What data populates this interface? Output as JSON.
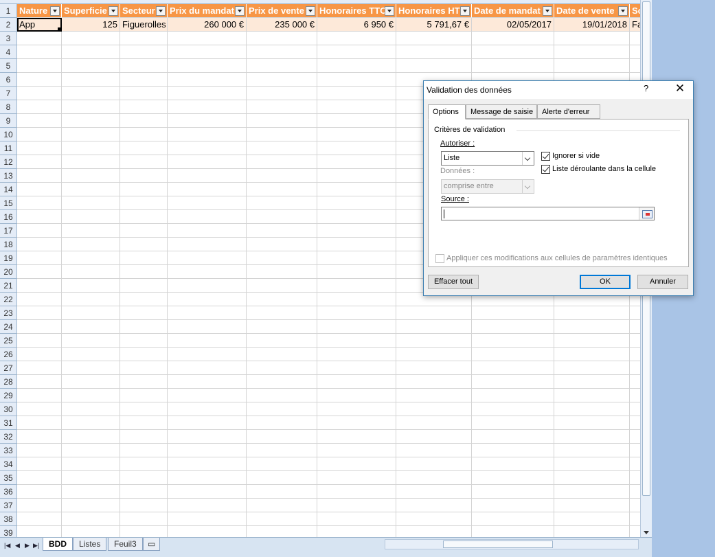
{
  "sheet": {
    "row_numbers": [
      "1",
      "2",
      "3",
      "4",
      "5",
      "6",
      "7",
      "8",
      "9",
      "10",
      "11",
      "12",
      "13",
      "14",
      "15",
      "16",
      "17",
      "18",
      "19",
      "20",
      "21",
      "22",
      "23",
      "24",
      "25",
      "26",
      "27",
      "28",
      "29",
      "30",
      "31",
      "32",
      "33",
      "34",
      "35",
      "36",
      "37",
      "38",
      "39"
    ],
    "headers": [
      "Nature",
      "Superficie",
      "Secteur",
      "Prix du mandat",
      "Prix de vente",
      "Honoraires TTC",
      "Honoraires HT",
      "Date de mandat",
      "Date de vente",
      "So"
    ],
    "row2": [
      "App",
      "125",
      "Figuerolles",
      "260 000 €",
      "235 000 €",
      "6 950 €",
      "5 791,67 €",
      "02/05/2017",
      "19/01/2018",
      "Fa"
    ],
    "header_color": "#f79646",
    "row_color": "#fde9d9"
  },
  "sheet_tabs": {
    "tabs": [
      "BDD",
      "Listes",
      "Feuil3"
    ],
    "active": "BDD"
  },
  "dialog": {
    "title": "Validation des données",
    "help": "?",
    "close": "✕",
    "tabs": [
      "Options",
      "Message de saisie",
      "Alerte d'erreur"
    ],
    "group_title": "Critères de validation",
    "allow_label": "Autoriser :",
    "allow_value": "Liste",
    "data_label": "Données :",
    "data_value": "comprise entre",
    "ignore_blank_label": "Ignorer si vide",
    "ignore_blank_checked": true,
    "dropdown_label": "Liste déroulante dans la cellule",
    "dropdown_checked": true,
    "source_label": "Source :",
    "source_value": "",
    "apply_all_label": "Appliquer ces modifications aux cellules de paramètres identiques",
    "apply_all_checked": false,
    "clear_all_label": "Effacer tout",
    "ok_label": "OK",
    "cancel_label": "Annuler"
  }
}
